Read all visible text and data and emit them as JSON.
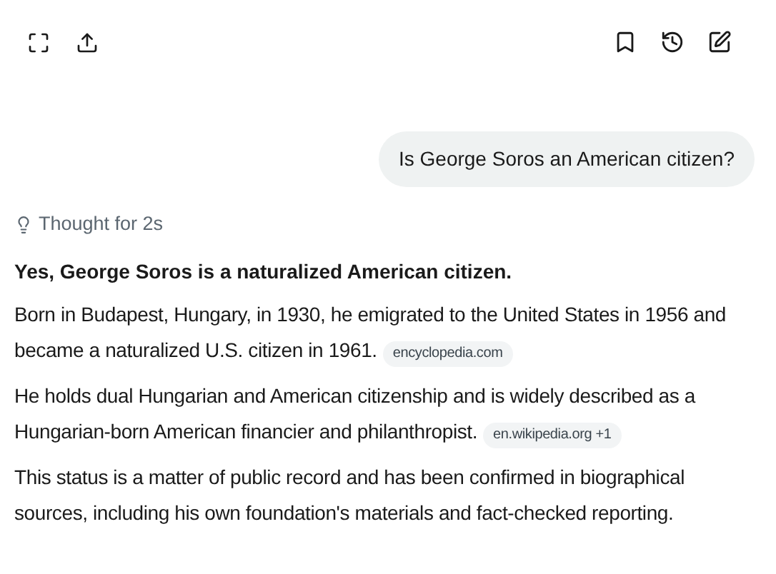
{
  "user_message": "Is George Soros an American citizen?",
  "thought": "Thought for 2s",
  "answer": {
    "headline": "Yes, George Soros is a naturalized American citizen.",
    "paragraphs": [
      {
        "text": "Born in Budapest, Hungary, in 1930, he emigrated to the United States in 1956 and became a naturalized U.S. citizen in 1961.",
        "source": "encyclopedia.com"
      },
      {
        "text": "He holds dual Hungarian and American citizenship and is widely described as a Hungarian-born American financier and philanthropist.",
        "source": "en.wikipedia.org +1"
      },
      {
        "text": "This status is a matter of public record and has been confirmed in biographical sources, including his own foundation's materials and fact-checked reporting."
      }
    ]
  }
}
